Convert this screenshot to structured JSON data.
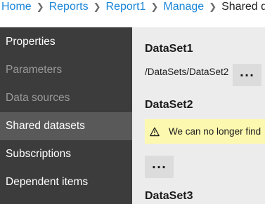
{
  "breadcrumb": {
    "items": [
      "Home",
      "Reports",
      "Report1",
      "Manage"
    ],
    "current": "Shared dat"
  },
  "sidebar": {
    "items": [
      {
        "label": "Properties",
        "state": "normal"
      },
      {
        "label": "Parameters",
        "state": "disabled"
      },
      {
        "label": "Data sources",
        "state": "disabled"
      },
      {
        "label": "Shared datasets",
        "state": "active"
      },
      {
        "label": "Subscriptions",
        "state": "normal"
      },
      {
        "label": "Dependent items",
        "state": "normal"
      }
    ]
  },
  "main": {
    "datasets": [
      {
        "title": "DataSet1",
        "path": "/DataSets/DataSet2"
      },
      {
        "title": "DataSet2",
        "warning": "We can no longer find"
      },
      {
        "title": "DataSet3"
      }
    ],
    "more_button_label": "···"
  },
  "colors": {
    "link": "#1a86d8",
    "sidebar_bg": "#3c3c3c",
    "sidebar_active": "#595959",
    "warning_bg": "#fdf8b0",
    "main_bg": "#ececec"
  }
}
